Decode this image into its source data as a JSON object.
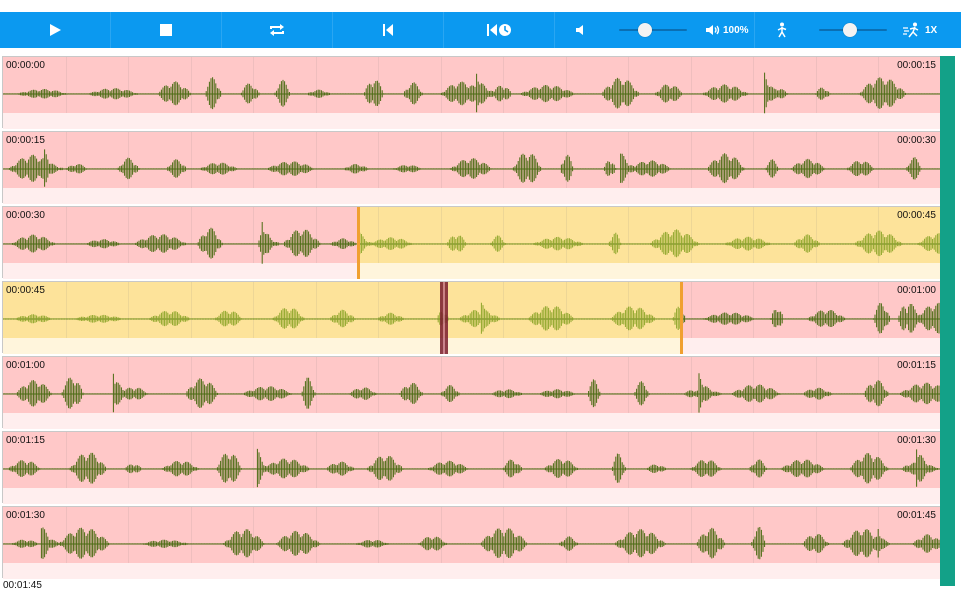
{
  "toolbar": {
    "buttons": [
      {
        "name": "play-button",
        "icon": "play-icon"
      },
      {
        "name": "stop-button",
        "icon": "stop-icon"
      },
      {
        "name": "loop-button",
        "icon": "repeat-icon"
      },
      {
        "name": "skip-back-button",
        "icon": "skip-back-icon"
      },
      {
        "name": "history-button",
        "icon": "history-icon"
      }
    ],
    "volume_label": "100%",
    "volume_level": 0.38,
    "speed_label": "1X",
    "speed_level": 0.45
  },
  "colors": {
    "toolbar": "#0b99f0",
    "segment_unlabeled": "#ffc8c8",
    "segment_selected": "#fde39a",
    "waveform": "#4a6b12",
    "waveform_selected": "#8ea52a",
    "marker": "#f0a030",
    "playhead": "#7a1d2e",
    "scrollbar": "#13a188"
  },
  "rows": [
    {
      "start": "00:00:00",
      "end": "00:00:15",
      "yellow": [],
      "markers": [],
      "cursor": null
    },
    {
      "start": "00:00:15",
      "end": "00:00:30",
      "yellow": [],
      "markers": [],
      "cursor": null
    },
    {
      "start": "00:00:30",
      "end": "00:00:45",
      "yellow": [
        [
          0.378,
          1.0
        ]
      ],
      "markers": [
        0.378
      ],
      "cursor": null
    },
    {
      "start": "00:00:45",
      "end": "00:01:00",
      "yellow": [
        [
          0.0,
          0.723
        ]
      ],
      "markers": [
        0.723
      ],
      "cursor": 0.47
    },
    {
      "start": "00:01:00",
      "end": "00:01:15",
      "yellow": [],
      "markers": [],
      "cursor": null
    },
    {
      "start": "00:01:15",
      "end": "00:01:30",
      "yellow": [],
      "markers": [],
      "cursor": null
    },
    {
      "start": "00:01:30",
      "end": "00:01:45",
      "yellow": [],
      "markers": [],
      "cursor": null
    }
  ],
  "next_row_start": "00:01:45"
}
